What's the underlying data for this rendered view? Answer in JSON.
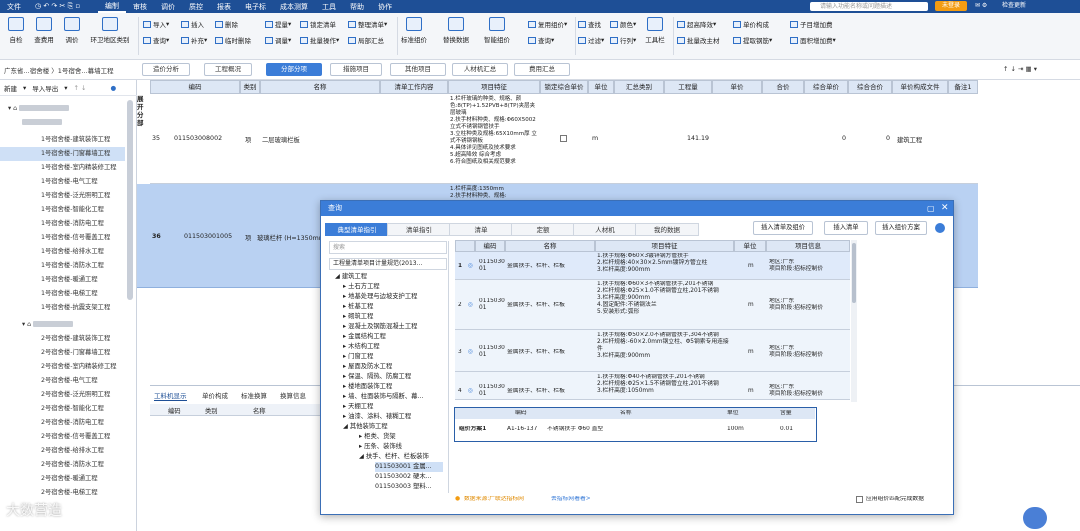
{
  "titlebar": {
    "file": "文件",
    "menus": [
      "编制",
      "审核",
      "调价",
      "质控",
      "报表",
      "电子标",
      "成本测算",
      "工具",
      "帮助",
      "协作"
    ],
    "search_placeholder": "请输入功能名称或问题描述",
    "login": "未登录",
    "check_update": "检查更新"
  },
  "ribbon": {
    "big": [
      "自检",
      "查费用",
      "调价",
      "环卫地区类别"
    ],
    "col1": [
      "导入",
      "查询"
    ],
    "col2": [
      "插入",
      "补充"
    ],
    "col3": [
      "删除",
      "临时删除"
    ],
    "col4": [
      "提量",
      "调量"
    ],
    "col5": [
      "锁定清单",
      "批量操作"
    ],
    "col6": [
      "整理清单",
      "局部汇总"
    ],
    "big2": [
      "标准组价",
      "替换数据",
      "智能组价"
    ],
    "col7": [
      "复用组价",
      "查询"
    ],
    "col8": [
      "查找",
      "过滤"
    ],
    "col9": [
      "颜色",
      "行列"
    ],
    "big3": [
      "工具栏"
    ],
    "col10": [
      "超高降效",
      "批量改主材"
    ],
    "col11": [
      "单价构成",
      "提取钢筋"
    ],
    "col12": [
      "子目增加费",
      "面积增加费"
    ]
  },
  "crumb": "广东省...宿舍楼 〉1号宿舍...幕墙工程",
  "page_tabs": [
    "造价分析",
    "工程概况",
    "分部分项",
    "措施项目",
    "其他项目",
    "人材机汇总",
    "费用汇总"
  ],
  "left": {
    "new": "新建",
    "io": "导入导出",
    "tree": [
      "1号宿舍楼-建筑装饰工程",
      "1号宿舍楼-门窗幕墙工程",
      "1号宿舍楼-室内精装修工程",
      "1号宿舍楼-电气工程",
      "1号宿舍楼-泛光照明工程",
      "1号宿舍楼-智能化工程",
      "1号宿舍楼-消防电工程",
      "1号宿舍楼-信号覆盖工程",
      "1号宿舍楼-给排水工程",
      "1号宿舍楼-消防水工程",
      "1号宿舍楼-暖通工程",
      "1号宿舍楼-电梯工程",
      "1号宿舍楼-抗震支架工程",
      "2号宿舍楼-建筑装饰工程",
      "2号宿舍楼-门窗幕墙工程",
      "2号宿舍楼-室内精装修工程",
      "2号宿舍楼-电气工程",
      "2号宿舍楼-泛光照明工程",
      "2号宿舍楼-智能化工程",
      "2号宿舍楼-消防电工程",
      "2号宿舍楼-信号覆盖工程",
      "2号宿舍楼-给排水工程",
      "2号宿舍楼-消防水工程",
      "2号宿舍楼-暖通工程",
      "2号宿舍楼-电梯工程"
    ]
  },
  "grid": {
    "headers": [
      "编码",
      "类别",
      "名称",
      "清单工作内容",
      "项目特征",
      "锁定综合单价",
      "单位",
      "汇总类别",
      "工程量",
      "单价",
      "合价",
      "综合单价",
      "综合合价",
      "单价构成文件",
      "备注1"
    ],
    "side_label": "展开分部",
    "row1": {
      "no": "35",
      "code": "011503008002",
      "type": "项",
      "name": "二层玻璃栏板",
      "feature": "1.栏杆玻璃的种类、规格、颜色:8(TP)+1.52PVB+8(TP)夹层夹层玻璃\n2.扶手材料种类、规格:Φ60X5002 立式不锈钢钢管扶手\n3.立柱种类及规格:65X10mm厚 立式不锈钢钢板\n4.具体详见图纸及技术要求\n5.超高降效 综合考虑\n6.符合图纸及相关规范要求",
      "unit": "m",
      "qty": "141.19",
      "zhdj": "0",
      "zhhj": "0",
      "file": "建筑工程"
    },
    "row2": {
      "no": "36",
      "code": "011503001005",
      "type": "项",
      "name": "玻璃栏杆 (H=1350mm",
      "feature": "1.栏杆高度:1350mm\n2.扶手材料种类、规格:"
    }
  },
  "bottom": {
    "tabs": [
      "工料机显示",
      "单价构成",
      "标准换算",
      "换算信息"
    ],
    "headers": [
      "编码",
      "类别",
      "名称"
    ]
  },
  "dialog": {
    "title": "查询",
    "tabs": [
      "典型清单指引",
      "清单指引",
      "清单",
      "定额",
      "人材机",
      "我的数据"
    ],
    "buttons": [
      "插入清单及组价",
      "插入清单",
      "插入组价方案"
    ],
    "search_placeholder": "搜索",
    "spec": "工程量清单项目计量规范(2013...",
    "tree": [
      "建筑工程",
      "土石方工程",
      "地基处理与边坡支护工程",
      "桩基工程",
      "砌筑工程",
      "混凝土及钢筋混凝土工程",
      "金属结构工程",
      "木结构工程",
      "门窗工程",
      "屋面及防水工程",
      "保温、隔热、防腐工程",
      "楼地面装饰工程",
      "墙、柱面装饰与隔断、幕...",
      "天棚工程",
      "油漆、涂料、裱糊工程",
      "其他装饰工程",
      "柜类、货架",
      "压条、装饰线",
      "扶手、栏杆、栏板装饰",
      "011503001 金属...",
      "011503002 硬木...",
      "011503003 塑料..."
    ],
    "grid_headers": [
      "编码",
      "名称",
      "项目特征",
      "单位",
      "项目信息"
    ],
    "rows": [
      {
        "no": "1",
        "code": "0115030\n01",
        "name": "金属扶手、栏杆、栏板",
        "feature": "1.扶手规格:Φ60×3镀锌钢方管扶手\n2.栏杆规格:40×30×2.5mm镀锌方管立柱\n3.栏杆高度:900mm",
        "unit": "m",
        "info": "地区:广东\n项目阶段:招标控制价"
      },
      {
        "no": "2",
        "code": "0115030\n01",
        "name": "金属扶手、栏杆、栏板",
        "feature": "1.扶手规格:Φ60×3不锈钢管扶手,201不锈钢\n2.栏杆规格:Φ25×1.0不锈钢管立柱,201不锈钢\n3.栏杆高度:900mm\n4.固定配件:不锈钢法兰\n5.安装形式:弧形",
        "unit": "m",
        "info": "地区:广东\n项目阶段:招标控制价"
      },
      {
        "no": "3",
        "code": "0115030\n01",
        "name": "金属扶手、栏杆、栏板",
        "feature": "1.扶手规格:Φ50×2.0不锈钢管扶手,304不锈钢\n2.栏杆规格:-60×2.0mm钢立柱、Φ5钢索专用连接件\n3.栏杆高度:900mm",
        "unit": "m",
        "info": "地区:广东\n项目阶段:招标控制价"
      },
      {
        "no": "4",
        "code": "0115030\n01",
        "name": "金属扶手、栏杆、栏板",
        "feature": "1.扶手规格:Φ40不锈钢管扶手,201不锈钢\n2.栏杆规格:Φ25×1.5不锈钢管立柱,201不锈钢\n3.栏杆高度:1050mm",
        "unit": "m",
        "info": "地区:广东\n项目阶段:招标控制价"
      }
    ],
    "scheme": {
      "headers": [
        "编码",
        "名称",
        "单位",
        "含量"
      ],
      "label": "组价方案1",
      "code": "A1-16-137",
      "name": "不锈钢扶手 Φ60 直型",
      "unit": "100m",
      "qty": "0.01"
    },
    "source": "数据来源:广联达指标网",
    "source_link": "去指标网看看>",
    "apply": "应用组价匹配完成数据"
  },
  "watermark": "大数营造"
}
